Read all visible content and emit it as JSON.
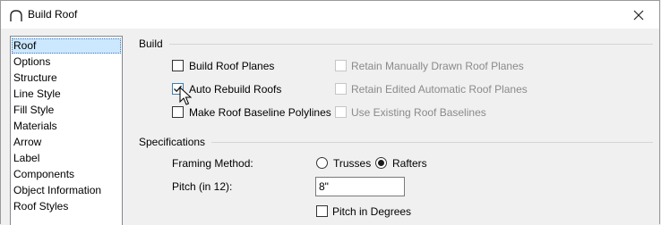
{
  "window": {
    "title": "Build Roof",
    "close_glyph": "✕"
  },
  "sidebar": {
    "items": [
      {
        "label": "Roof",
        "selected": true
      },
      {
        "label": "Options"
      },
      {
        "label": "Structure"
      },
      {
        "label": "Line Style"
      },
      {
        "label": "Fill Style"
      },
      {
        "label": "Materials"
      },
      {
        "label": "Arrow"
      },
      {
        "label": "Label"
      },
      {
        "label": "Components"
      },
      {
        "label": "Object Information"
      },
      {
        "label": "Roof Styles"
      }
    ]
  },
  "build": {
    "heading": "Build",
    "left": [
      {
        "label": "Build Roof Planes",
        "checked": false
      },
      {
        "label": "Auto Rebuild Roofs",
        "checked": true
      },
      {
        "label": "Make Roof Baseline Polylines",
        "checked": false
      }
    ],
    "right": [
      {
        "label": "Retain Manually Drawn Roof Planes",
        "checked": false,
        "enabled": false
      },
      {
        "label": "Retain Edited Automatic Roof Planes",
        "checked": false,
        "enabled": false
      },
      {
        "label": "Use Existing Roof Baselines",
        "checked": false,
        "enabled": false
      }
    ]
  },
  "specifications": {
    "heading": "Specifications",
    "framing_label": "Framing Method:",
    "framing_options": [
      {
        "label": "Trusses",
        "selected": false
      },
      {
        "label": "Rafters",
        "selected": true
      }
    ],
    "pitch_label": "Pitch (in 12):",
    "pitch_value": "8\"",
    "pitch_degrees_label": "Pitch in Degrees",
    "pitch_degrees_checked": false
  },
  "icons": {
    "app": "roof-arc-icon",
    "close": "close-icon",
    "check": "check-icon",
    "cursor": "mouse-pointer-icon"
  }
}
